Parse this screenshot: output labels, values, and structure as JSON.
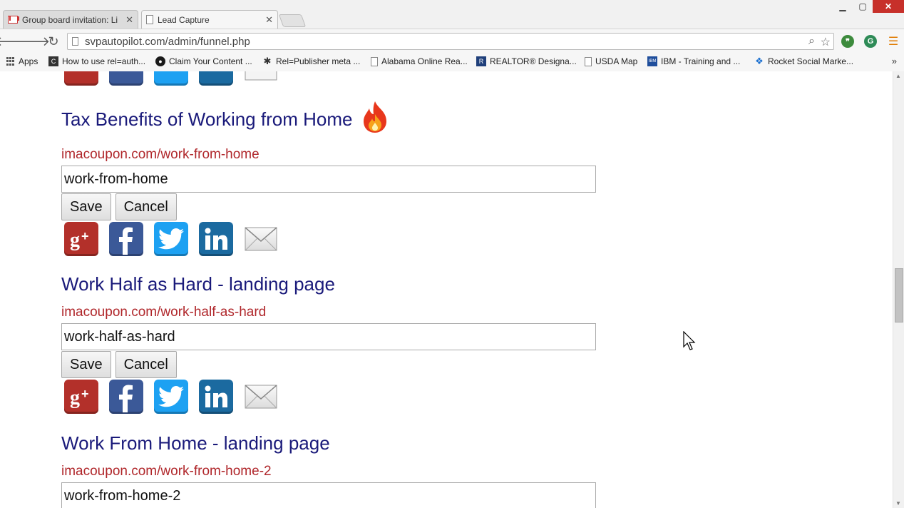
{
  "browser": {
    "tabs": [
      {
        "title": "Group board invitation: Li",
        "active": false,
        "favicon": "gmail-icon"
      },
      {
        "title": "Lead Capture",
        "active": true,
        "favicon": "page-icon"
      }
    ],
    "url": "svpautopilot.com/admin/funnel.php",
    "bookmarks": [
      {
        "label": "Apps"
      },
      {
        "label": "How to use rel=auth..."
      },
      {
        "label": "Claim Your Content ..."
      },
      {
        "label": "Rel=Publisher meta ..."
      },
      {
        "label": "Alabama Online Rea..."
      },
      {
        "label": "REALTOR® Designa..."
      },
      {
        "label": "USDA Map"
      },
      {
        "label": "IBM - Training and ..."
      },
      {
        "label": "Rocket Social Marke..."
      }
    ],
    "bookmarks_more": "»"
  },
  "funnels": [
    {
      "title": "Tax Benefits of Working from Home",
      "url": "imacoupon.com/work-from-home",
      "slug": "work-from-home",
      "save_label": "Save",
      "cancel_label": "Cancel",
      "hot": true
    },
    {
      "title": "Work Half as Hard - landing page",
      "url": "imacoupon.com/work-half-as-hard",
      "slug": "work-half-as-hard",
      "save_label": "Save",
      "cancel_label": "Cancel",
      "hot": false
    },
    {
      "title": "Work From Home - landing page",
      "url": "imacoupon.com/work-from-home-2",
      "slug": "work-from-home-2",
      "save_label": "Save",
      "cancel_label": "Cancel",
      "hot": false
    }
  ],
  "share_icons": [
    "google-plus-icon",
    "facebook-icon",
    "twitter-icon",
    "linkedin-icon",
    "email-icon"
  ],
  "colors": {
    "title": "#1a1a7a",
    "url": "#b0272b",
    "gplus": "#b3302a",
    "facebook": "#3b5998",
    "twitter": "#1da1f2",
    "linkedin": "#1b6aa0"
  }
}
